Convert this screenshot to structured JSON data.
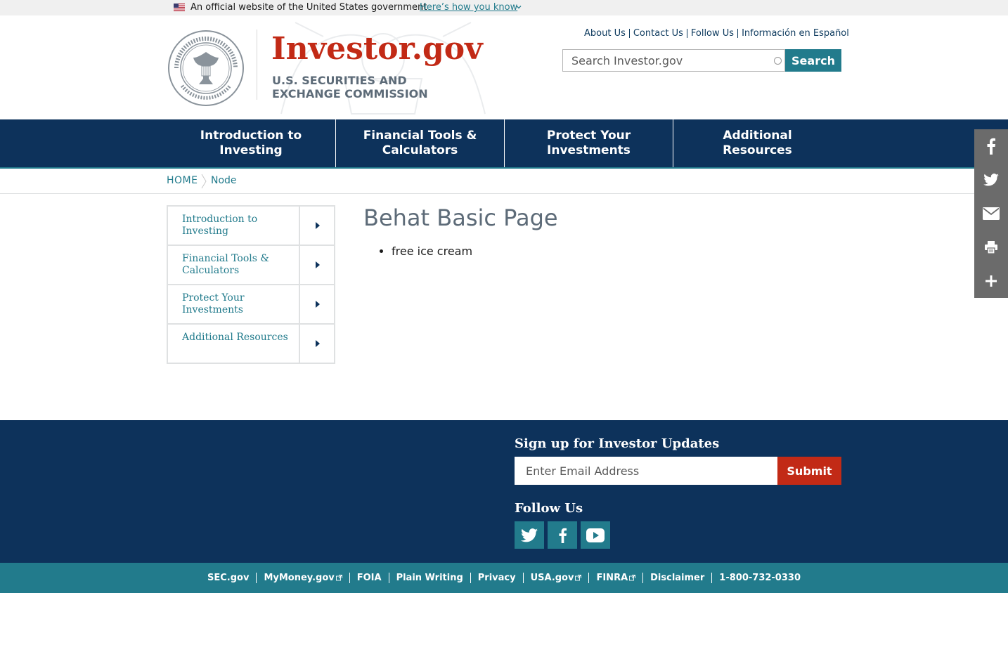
{
  "gov_banner": {
    "official_text": "An official website of the United States government",
    "how_you_know": "Here’s how you know"
  },
  "header": {
    "logo_title": "Investor.gov",
    "logo_sub_line1": "U.S. SECURITIES AND",
    "logo_sub_line2": "EXCHANGE COMMISSION",
    "utility_links": [
      "About Us",
      "Contact Us",
      "Follow Us",
      "Información en Español"
    ],
    "search": {
      "placeholder": "Search Investor.gov",
      "button": "Search"
    }
  },
  "main_nav": [
    {
      "label": "Introduction to Investing"
    },
    {
      "label": "Financial Tools & Calculators"
    },
    {
      "label": "Protect Your Investments"
    },
    {
      "label": "Additional Resources"
    }
  ],
  "breadcrumb": {
    "home": "HOME",
    "current": "Node"
  },
  "sidebar": [
    {
      "label": "Introduction to Investing"
    },
    {
      "label": "Financial Tools & Calculators"
    },
    {
      "label": "Protect Your Investments"
    },
    {
      "label": "Additional Resources"
    }
  ],
  "content": {
    "title": "Behat Basic Page",
    "items": [
      "free ice cream"
    ]
  },
  "share_rail": [
    "facebook-icon",
    "twitter-icon",
    "email-icon",
    "print-icon",
    "plus-icon"
  ],
  "footer": {
    "signup_title": "Sign up for Investor Updates",
    "email_placeholder": "Enter Email Address",
    "submit": "Submit",
    "follow_title": "Follow Us",
    "social": [
      "twitter-icon",
      "facebook-icon",
      "youtube-icon"
    ],
    "bottom_links": [
      "SEC.gov",
      "MyMoney.gov",
      "FOIA",
      "Plain Writing",
      "Privacy",
      "USA.gov",
      "FINRA",
      "Disclaimer",
      "1-800-732-0330"
    ]
  },
  "colors": {
    "brand_red": "#c22a16",
    "navy": "#0d325b",
    "teal": "#227b8c",
    "share_gray": "#6b6b6b"
  }
}
